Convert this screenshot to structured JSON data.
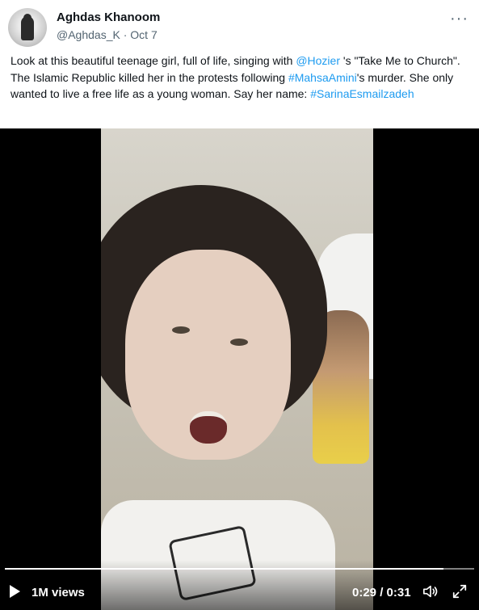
{
  "author": {
    "display_name": "Aghdas Khanoom",
    "handle": "@Aghdas_K",
    "separator": "·",
    "date": "Oct 7"
  },
  "more_icon": "more-horizontal-icon",
  "tweet": {
    "part1": "Look at this beautiful teenage girl, full of life, singing with ",
    "mention": "@Hozier",
    "part2": " 's \"Take Me to Church\". The Islamic Republic killed her in the protests following ",
    "hashtag1": "#MahsaAmini",
    "part3": "'s murder. She only wanted to live a free life as a young woman. Say her name: ",
    "hashtag2": "#SarinaEsmailzadeh"
  },
  "video": {
    "views": "1M views",
    "time": "0:29 / 0:31",
    "progress": 0.935,
    "icons": [
      "play-icon",
      "volume-icon",
      "fullscreen-icon"
    ]
  },
  "colors": {
    "link": "#1d9bf0",
    "text": "#0f1419",
    "secondary": "#536471"
  }
}
